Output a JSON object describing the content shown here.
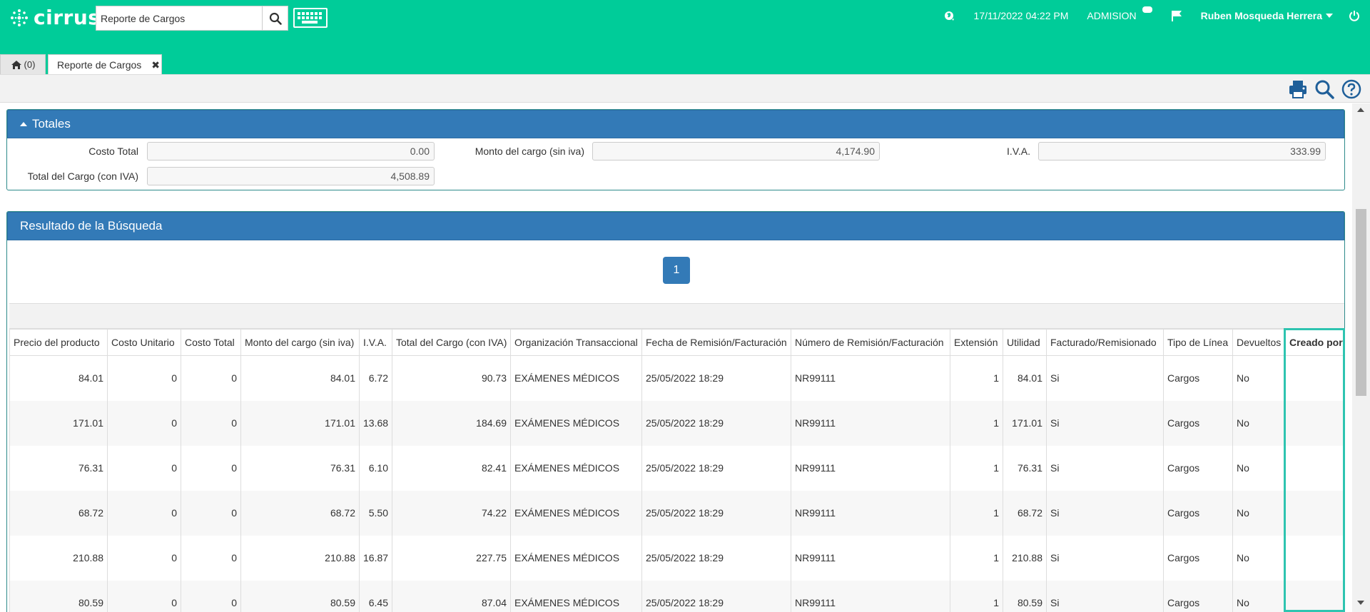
{
  "app": {
    "logo_text": "cirrus",
    "search_value": "Reporte de Cargos",
    "datetime": "17/11/2022 04:22 PM",
    "module": "ADMISION",
    "user": "Ruben Mosqueda Herrera"
  },
  "tabs": {
    "home_label": "(0)",
    "active_label": "Reporte de Cargos"
  },
  "totals": {
    "title": "Totales",
    "costo_total_label": "Costo Total",
    "costo_total_value": "0.00",
    "monto_label": "Monto del cargo (sin iva)",
    "monto_value": "4,174.90",
    "iva_label": "I.V.A.",
    "iva_value": "333.99",
    "total_label": "Total del Cargo (con IVA)",
    "total_value": "4,508.89"
  },
  "results": {
    "title": "Resultado de la Búsqueda",
    "page": "1",
    "columns": [
      "Precio del producto",
      "Costo Unitario",
      "Costo Total",
      "Monto del cargo (sin iva)",
      "I.V.A.",
      "Total del Cargo (con IVA)",
      "Organización Transaccional",
      "Fecha de Remisión/Facturación",
      "Número de Remisión/Facturación",
      "Extensión",
      "Utilidad",
      "Facturado/Remisionado",
      "Tipo de Línea",
      "Devueltos",
      "Creado por"
    ],
    "rows": [
      [
        "84.01",
        "0",
        "0",
        "84.01",
        "6.72",
        "90.73",
        "EXÁMENES MÉDICOS",
        "25/05/2022 18:29",
        "NR99111",
        "1",
        "84.01",
        "Si",
        "Cargos",
        "No",
        ""
      ],
      [
        "171.01",
        "0",
        "0",
        "171.01",
        "13.68",
        "184.69",
        "EXÁMENES MÉDICOS",
        "25/05/2022 18:29",
        "NR99111",
        "1",
        "171.01",
        "Si",
        "Cargos",
        "No",
        ""
      ],
      [
        "76.31",
        "0",
        "0",
        "76.31",
        "6.10",
        "82.41",
        "EXÁMENES MÉDICOS",
        "25/05/2022 18:29",
        "NR99111",
        "1",
        "76.31",
        "Si",
        "Cargos",
        "No",
        ""
      ],
      [
        "68.72",
        "0",
        "0",
        "68.72",
        "5.50",
        "74.22",
        "EXÁMENES MÉDICOS",
        "25/05/2022 18:29",
        "NR99111",
        "1",
        "68.72",
        "Si",
        "Cargos",
        "No",
        ""
      ],
      [
        "210.88",
        "0",
        "0",
        "210.88",
        "16.87",
        "227.75",
        "EXÁMENES MÉDICOS",
        "25/05/2022 18:29",
        "NR99111",
        "1",
        "210.88",
        "Si",
        "Cargos",
        "No",
        ""
      ],
      [
        "80.59",
        "0",
        "0",
        "80.59",
        "6.45",
        "87.04",
        "EXÁMENES MÉDICOS",
        "25/05/2022 18:29",
        "NR99111",
        "1",
        "80.59",
        "Si",
        "Cargos",
        "No",
        ""
      ]
    ]
  },
  "colors": {
    "header": "#00cc99",
    "panel": "#337ab7",
    "highlight": "#2ec4b0"
  },
  "icons": [
    "cirrus-logo-icon",
    "search-icon",
    "keyboard-icon",
    "globe-icon",
    "notification-icon",
    "flag-icon",
    "user-caret-icon",
    "power-icon",
    "home-icon",
    "close-icon",
    "print-icon",
    "magnifier-icon",
    "help-icon"
  ]
}
